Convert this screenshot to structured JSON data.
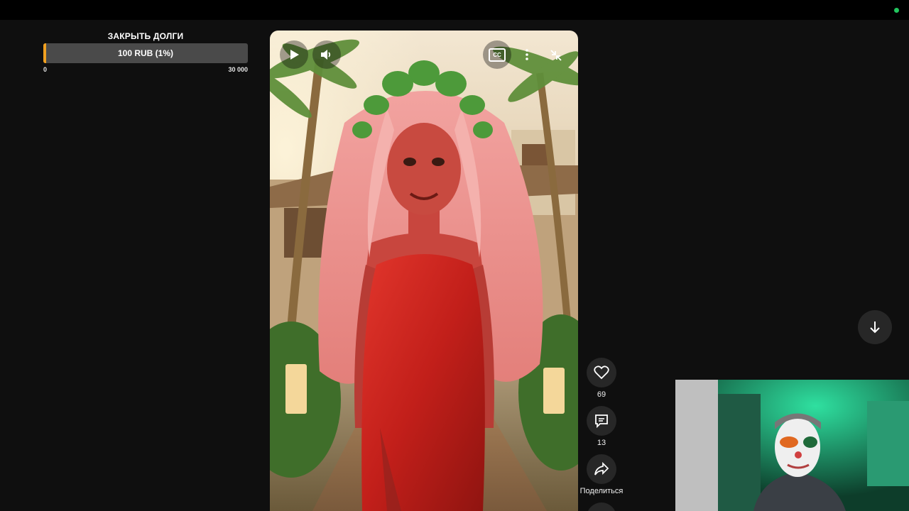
{
  "goal": {
    "title": "ЗАКРЫТЬ ДОЛГИ",
    "progress_label": "100 RUB (1%)",
    "progress_fraction": 0.01,
    "min": "0",
    "max": "30 000",
    "accent_color": "#f0a020"
  },
  "player": {
    "icons": {
      "play": "play-icon",
      "volume": "volume-icon",
      "captions": "closed-captions-icon",
      "more": "more-vertical-icon",
      "exit_fullscreen": "exit-fullscreen-icon"
    },
    "captions_label": "CC"
  },
  "actions": {
    "like_count": "69",
    "comment_count": "13",
    "share_label": "Поделиться"
  },
  "colors": {
    "background": "#0f0f0f",
    "button_bg": "#272727",
    "live_indicator": "#22c55e"
  }
}
